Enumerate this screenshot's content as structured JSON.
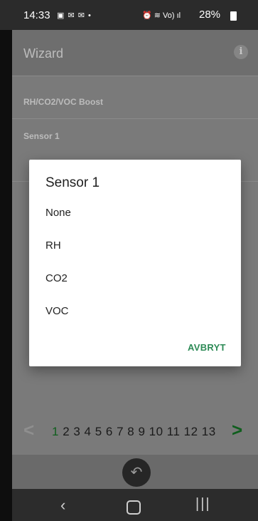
{
  "status": {
    "time": "14:33",
    "notification_icons": "▣ ✉ ✉ •",
    "right_icons": "⏰ ≋ Vo) ıl",
    "battery": "28%"
  },
  "appbar": {
    "title": "Wizard",
    "info_icon": "i"
  },
  "content": {
    "section_label": "RH/CO2/VOC Boost",
    "sensor_label": "Sensor 1"
  },
  "pager": {
    "prev": "<",
    "current_page": "1",
    "other_pages": "2 3 4 5 6 7 8 9 10 11 12 13",
    "next": ">"
  },
  "dialog": {
    "title": "Sensor 1",
    "options": [
      "None",
      "RH",
      "CO2",
      "VOC"
    ],
    "cancel_label": "AVBRYT"
  },
  "nav": {
    "back": "‹",
    "recent": "|||"
  }
}
